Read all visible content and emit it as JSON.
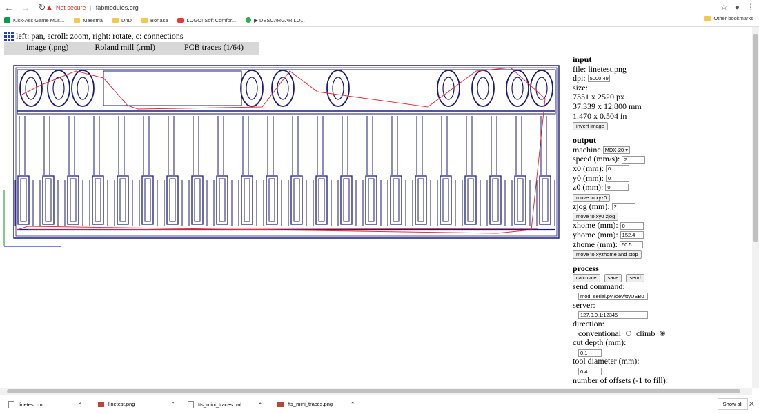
{
  "browser": {
    "not_secure": "Not secure",
    "url": "fabmodules.org",
    "bookmarks": [
      "Kick-Ass Game Mus...",
      "Maestria",
      "DnD",
      "Bonasa",
      "LOGO! Soft Comfor...",
      "▶ DESCARGAR LO..."
    ],
    "other_bookmarks": "Other bookmarks"
  },
  "hint": "left: pan, scroll: zoom, right: rotate, c: connections",
  "tabs": [
    "image (.png)",
    "Roland mill (.rml)",
    "PCB traces (1/64)"
  ],
  "input": {
    "title": "input",
    "file": "file: linetest.png",
    "dpi_label": "dpi:",
    "dpi_value": "5000.49",
    "size_label": "size:",
    "size_px": "7351 x 2520 px",
    "size_mm": "37.339 x 12.800 mm",
    "size_in": "1.470 x 0.504 in",
    "invert_button": "invert image"
  },
  "output": {
    "title": "output",
    "machine_label": "machine",
    "machine_value": "MDX-20",
    "speed_label": "speed (mm/s):",
    "speed_value": "2",
    "x0_label": "x0 (mm):",
    "x0_value": "0",
    "y0_label": "y0 (mm):",
    "y0_value": "0",
    "z0_label": "z0 (mm):",
    "z0_value": "0",
    "move_xyz0": "move to xyz0",
    "zjog_label": "zjog (mm):",
    "zjog_value": "2",
    "move_xy0_zjog": "move to xy0 zjog",
    "xhome_label": "xhome (mm):",
    "xhome_value": "0",
    "yhome_label": "yhome (mm):",
    "yhome_value": "152.4",
    "zhome_label": "zhome (mm):",
    "zhome_value": "60.5",
    "move_xyzhome": "move to xyzhome and stop"
  },
  "process": {
    "title": "process",
    "calculate": "calculate",
    "save": "save",
    "send": "send",
    "send_command_label": "send command:",
    "send_command_value": "mod_serial.py /dev/ttyUSB0",
    "server_label": "server:",
    "server_value": "127.0.0.1:12345",
    "direction_label": "direction:",
    "conventional": "conventional",
    "climb": "climb",
    "cut_depth_label": "cut depth (mm):",
    "cut_depth_value": "0.1",
    "tool_diameter_label": "tool diameter (mm):",
    "tool_diameter_value": "0.4",
    "offsets_label": "number of offsets (-1 to fill):"
  },
  "downloads": [
    "linetest.rml",
    "linetest.png",
    "fts_mini_traces.rml",
    "fts_mini_traces.png"
  ],
  "show_all": "Show all",
  "colors": {
    "trace": "#1b1b7a",
    "move": "#e0303a",
    "axis_x": "#2a3bd6",
    "axis_y": "#2aa84a"
  }
}
